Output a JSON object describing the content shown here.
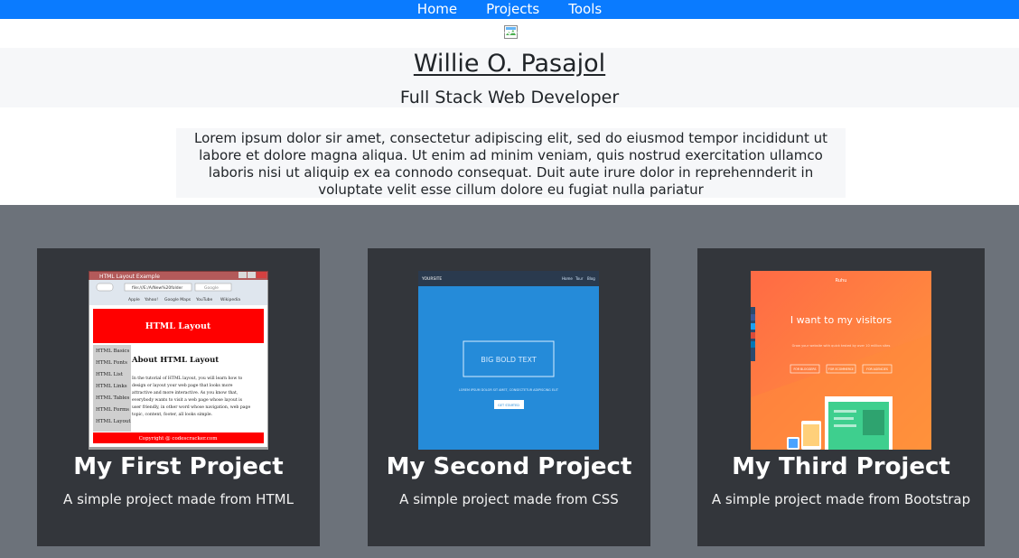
{
  "nav": {
    "items": [
      {
        "label": "Home"
      },
      {
        "label": "Projects"
      },
      {
        "label": "Tools"
      }
    ],
    "bg_color": "#0a7bff"
  },
  "header": {
    "name": "Willie O. Pasajol",
    "role": "Full Stack Web Developer"
  },
  "about": {
    "text": "Lorem ipsum dolor sir amet, consectetur adipiscing elit, sed do eiusmod tempor incididunt ut labore et dolore magna aliqua. Ut enim ad minim veniam, quis nostrud exercitation ullamco laboris nisi ut aliquip ex ea connodo consequat. Duit aute irure dolor in reprehennderit in voluptate velit esse cillum dolore eu fugiat nulla pariatur"
  },
  "projects": {
    "bg_color": "#6c727a",
    "card_color": "#33363b",
    "items": [
      {
        "title": "My First Project",
        "subtitle": "A simple project made from HTML",
        "screenshot": {
          "window_title": "HTML Layout Example",
          "address": "file:///E:/A/New%20folder",
          "search": "Google",
          "bookmarks": [
            "Apple",
            "Yahoo!",
            "Google Maps",
            "YouTube",
            "Wikipedia"
          ],
          "banner": "HTML Layout",
          "sidebar": [
            "HTML Basics",
            "HTML Fonts",
            "HTML List",
            "HTML Links",
            "HTML Tables",
            "HTML Forms",
            "HTML Layout"
          ],
          "heading": "About HTML Layout",
          "body_lines": [
            "In the tutorial of HTML layout, you will learn how to",
            "design or layout your web page that looks more",
            "attractive and more interactive. As you know that,",
            "everybody wants to visit a web page whose layout is",
            "user friendly, in other word whose navigation, web page",
            "topic, content, footer, all looks simple."
          ],
          "footer": "Copyright @ codescracker.com"
        }
      },
      {
        "title": "My Second Project",
        "subtitle": "A simple project made from CSS",
        "screenshot": {
          "logo": "YOURSITE",
          "links": [
            "Home",
            "Tour",
            "Blog"
          ],
          "headline": "BIG BOLD TEXT",
          "tagline": "LOREM IPSUM DOLOR SIT AMET, CONSECTETUR ADIPISCING ELIT",
          "cta": "GET STARTED"
        }
      },
      {
        "title": "My Third Project",
        "subtitle": "A simple project made from Bootstrap",
        "screenshot": {
          "brand": "Ruhu",
          "headline": "I want to  my visitors",
          "sub": "Grow your website with quick tested by over 10 million sites",
          "buttons": [
            "FOR BLOGGERS",
            "FOR ECOMMERCE",
            "FOR AGENCIES"
          ]
        }
      }
    ]
  }
}
